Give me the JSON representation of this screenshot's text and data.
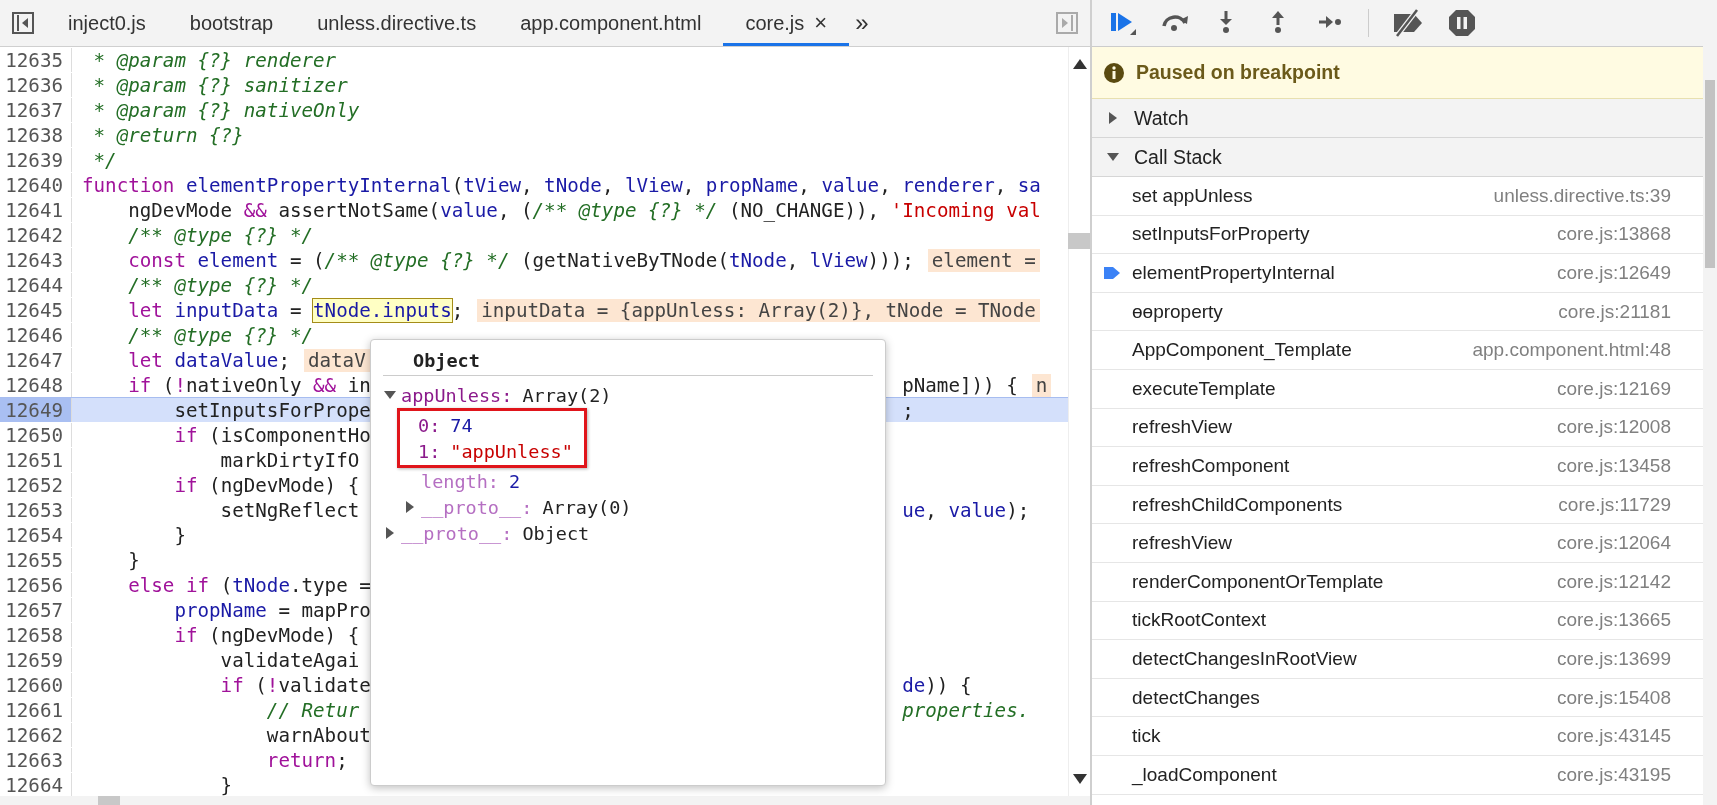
{
  "tabs": [
    {
      "label": "inject0.js",
      "selected": false
    },
    {
      "label": "bootstrap",
      "selected": false
    },
    {
      "label": "unless.directive.ts",
      "selected": false
    },
    {
      "label": "app.component.html",
      "selected": false
    },
    {
      "label": "core.js",
      "selected": true,
      "close": "×"
    }
  ],
  "tab_overflow": "»",
  "code_lines": [
    {
      "number": "12635",
      "current": false,
      "tokens": [
        {
          "kind": "comment",
          "text": " * @param {?} renderer"
        }
      ]
    },
    {
      "number": "12636",
      "current": false,
      "tokens": [
        {
          "kind": "comment",
          "text": " * @param {?} sanitizer"
        }
      ]
    },
    {
      "number": "12637",
      "current": false,
      "tokens": [
        {
          "kind": "comment",
          "text": " * @param {?} nativeOnly"
        }
      ]
    },
    {
      "number": "12638",
      "current": false,
      "tokens": [
        {
          "kind": "comment",
          "text": " * @return {?}"
        }
      ]
    },
    {
      "number": "12639",
      "current": false,
      "tokens": [
        {
          "kind": "comment",
          "text": " */"
        }
      ]
    },
    {
      "number": "12640",
      "current": false,
      "tokens": [
        {
          "kind": "keyword",
          "text": "function"
        },
        {
          "kind": "variable",
          "text": " elementPropertyInternal"
        },
        {
          "kind": "plain",
          "text": "("
        },
        {
          "kind": "variable",
          "text": "tView"
        },
        {
          "kind": "plain",
          "text": ", "
        },
        {
          "kind": "variable",
          "text": "tNode"
        },
        {
          "kind": "plain",
          "text": ", "
        },
        {
          "kind": "variable",
          "text": "lView"
        },
        {
          "kind": "plain",
          "text": ", "
        },
        {
          "kind": "variable",
          "text": "propName"
        },
        {
          "kind": "plain",
          "text": ", "
        },
        {
          "kind": "variable",
          "text": "value"
        },
        {
          "kind": "plain",
          "text": ", "
        },
        {
          "kind": "variable",
          "text": "renderer"
        },
        {
          "kind": "plain",
          "text": ", "
        },
        {
          "kind": "variable",
          "text": "sa"
        }
      ]
    },
    {
      "number": "12641",
      "current": false,
      "tokens": [
        {
          "kind": "plain",
          "text": "    ngDevMode "
        },
        {
          "kind": "keyword",
          "text": "&&"
        },
        {
          "kind": "plain",
          "text": " assertNotSame("
        },
        {
          "kind": "variable",
          "text": "value"
        },
        {
          "kind": "plain",
          "text": ", ("
        },
        {
          "kind": "comment",
          "text": "/** @type {?} */"
        },
        {
          "kind": "plain",
          "text": " (NO_CHANGE)), "
        },
        {
          "kind": "string",
          "text": "'Incoming val"
        }
      ]
    },
    {
      "number": "12642",
      "current": false,
      "tokens": [
        {
          "kind": "comment",
          "text": "    /** @type {?} */"
        }
      ]
    },
    {
      "number": "12643",
      "current": false,
      "tokens": [
        {
          "kind": "keyword",
          "text": "    const"
        },
        {
          "kind": "variable",
          "text": " element"
        },
        {
          "kind": "plain",
          "text": " = ("
        },
        {
          "kind": "comment",
          "text": "/** @type {?} */"
        },
        {
          "kind": "plain",
          "text": " (getNativeByTNode("
        },
        {
          "kind": "variable",
          "text": "tNode"
        },
        {
          "kind": "plain",
          "text": ", "
        },
        {
          "kind": "variable",
          "text": "lView"
        },
        {
          "kind": "plain",
          "text": ")));"
        },
        {
          "kind": "inline",
          "text": "element ="
        }
      ]
    },
    {
      "number": "12644",
      "current": false,
      "tokens": [
        {
          "kind": "comment",
          "text": "    /** @type {?} */"
        }
      ]
    },
    {
      "number": "12645",
      "current": false,
      "tokens": [
        {
          "kind": "keyword",
          "text": "    let"
        },
        {
          "kind": "variable",
          "text": " inputData"
        },
        {
          "kind": "plain",
          "text": " = "
        },
        {
          "kind": "hover",
          "text": "tNode.inputs"
        },
        {
          "kind": "plain",
          "text": ";"
        },
        {
          "kind": "inline",
          "text": "inputData = {appUnless: Array(2)}, tNode = TNode"
        }
      ]
    },
    {
      "number": "12646",
      "current": false,
      "tokens": [
        {
          "kind": "comment",
          "text": "    /** @type {?} */"
        }
      ]
    },
    {
      "number": "12647",
      "current": false,
      "tokens": [
        {
          "kind": "keyword",
          "text": "    let"
        },
        {
          "kind": "variable",
          "text": " dataValue"
        },
        {
          "kind": "plain",
          "text": ";"
        },
        {
          "kind": "inline",
          "text": "dataV"
        }
      ]
    },
    {
      "number": "12648",
      "current": false,
      "tokens": [
        {
          "kind": "keyword",
          "text": "    if"
        },
        {
          "kind": "plain",
          "text": " ("
        },
        {
          "kind": "keyword",
          "text": "!"
        },
        {
          "kind": "plain",
          "text": "nativeOnly "
        },
        {
          "kind": "keyword",
          "text": "&&"
        },
        {
          "kind": "plain",
          "text": " in"
        }
      ],
      "right": [
        {
          "kind": "plain",
          "text": "pName])) {"
        },
        {
          "kind": "inline",
          "text": "n"
        }
      ]
    },
    {
      "number": "12649",
      "current": true,
      "tokens": [
        {
          "kind": "plain",
          "text": "        setInputsForPrope"
        }
      ],
      "right": [
        {
          "kind": "plain",
          "text": ";"
        }
      ]
    },
    {
      "number": "12650",
      "current": false,
      "tokens": [
        {
          "kind": "keyword",
          "text": "        if"
        },
        {
          "kind": "plain",
          "text": " (isComponentHo"
        }
      ]
    },
    {
      "number": "12651",
      "current": false,
      "tokens": [
        {
          "kind": "plain",
          "text": "            markDirtyIfO"
        }
      ]
    },
    {
      "number": "12652",
      "current": false,
      "tokens": [
        {
          "kind": "keyword",
          "text": "        if"
        },
        {
          "kind": "plain",
          "text": " (ngDevMode) {"
        }
      ]
    },
    {
      "number": "12653",
      "current": false,
      "tokens": [
        {
          "kind": "plain",
          "text": "            setNgReflect"
        }
      ],
      "right": [
        {
          "kind": "variable",
          "text": "ue"
        },
        {
          "kind": "plain",
          "text": ", "
        },
        {
          "kind": "variable",
          "text": "value"
        },
        {
          "kind": "plain",
          "text": ");"
        }
      ]
    },
    {
      "number": "12654",
      "current": false,
      "tokens": [
        {
          "kind": "plain",
          "text": "        }"
        }
      ]
    },
    {
      "number": "12655",
      "current": false,
      "tokens": [
        {
          "kind": "plain",
          "text": "    }"
        }
      ]
    },
    {
      "number": "12656",
      "current": false,
      "tokens": [
        {
          "kind": "keyword",
          "text": "    else if"
        },
        {
          "kind": "plain",
          "text": " ("
        },
        {
          "kind": "variable",
          "text": "tNode"
        },
        {
          "kind": "plain",
          "text": ".type ="
        }
      ]
    },
    {
      "number": "12657",
      "current": false,
      "tokens": [
        {
          "kind": "variable",
          "text": "        propName"
        },
        {
          "kind": "plain",
          "text": " = mapPro"
        }
      ]
    },
    {
      "number": "12658",
      "current": false,
      "tokens": [
        {
          "kind": "keyword",
          "text": "        if"
        },
        {
          "kind": "plain",
          "text": " (ngDevMode) {"
        }
      ]
    },
    {
      "number": "12659",
      "current": false,
      "tokens": [
        {
          "kind": "plain",
          "text": "            validateAgai"
        }
      ]
    },
    {
      "number": "12660",
      "current": false,
      "tokens": [
        {
          "kind": "keyword",
          "text": "            if"
        },
        {
          "kind": "plain",
          "text": " ("
        },
        {
          "kind": "keyword",
          "text": "!"
        },
        {
          "kind": "plain",
          "text": "validate"
        }
      ],
      "right": [
        {
          "kind": "variable",
          "text": "de"
        },
        {
          "kind": "plain",
          "text": ")) {"
        }
      ]
    },
    {
      "number": "12661",
      "current": false,
      "tokens": [
        {
          "kind": "comment",
          "text": "                // Retur"
        }
      ],
      "right": [
        {
          "kind": "comment",
          "text": "properties."
        }
      ]
    },
    {
      "number": "12662",
      "current": false,
      "tokens": [
        {
          "kind": "plain",
          "text": "                warnAbout"
        }
      ]
    },
    {
      "number": "12663",
      "current": false,
      "tokens": [
        {
          "kind": "keyword",
          "text": "                return"
        },
        {
          "kind": "plain",
          "text": ";"
        }
      ]
    },
    {
      "number": "12664",
      "current": false,
      "tokens": [
        {
          "kind": "plain",
          "text": "            }"
        }
      ]
    }
  ],
  "popover": {
    "title": "Object",
    "tree": [
      {
        "key": "appUnless:",
        "value": "Array(2)",
        "kind": "plain",
        "expanded": true,
        "children": [
          {
            "key": "0:",
            "value": "74",
            "kind": "number",
            "highlighted": true
          },
          {
            "key": "1:",
            "value": "\"appUnless\"",
            "kind": "string",
            "highlighted": true
          },
          {
            "key": "length:",
            "value": "2",
            "kind": "number",
            "highlighted": false,
            "faded": true
          },
          {
            "key": "__proto__:",
            "value": "Array(0)",
            "kind": "plain",
            "expanded": false,
            "highlighted": false,
            "faded": true
          }
        ]
      },
      {
        "key": "__proto__:",
        "value": "Object",
        "kind": "plain",
        "expanded": false,
        "faded": true
      }
    ]
  },
  "pause_banner": "Paused on breakpoint",
  "sections": [
    {
      "title": "Watch",
      "expanded": false
    },
    {
      "title": "Call Stack",
      "expanded": true
    }
  ],
  "call_stack": [
    {
      "name": "set appUnless",
      "location": "unless.directive.ts:39",
      "selected": false
    },
    {
      "name": "setInputsForProperty",
      "location": "core.js:13868",
      "selected": false
    },
    {
      "name": "elementPropertyInternal",
      "location": "core.js:12649",
      "selected": true
    },
    {
      "name": "ɵɵproperty",
      "location": "core.js:21181",
      "selected": false
    },
    {
      "name": "AppComponent_Template",
      "location": "app.component.html:48",
      "selected": false
    },
    {
      "name": "executeTemplate",
      "location": "core.js:12169",
      "selected": false
    },
    {
      "name": "refreshView",
      "location": "core.js:12008",
      "selected": false
    },
    {
      "name": "refreshComponent",
      "location": "core.js:13458",
      "selected": false
    },
    {
      "name": "refreshChildComponents",
      "location": "core.js:11729",
      "selected": false
    },
    {
      "name": "refreshView",
      "location": "core.js:12064",
      "selected": false
    },
    {
      "name": "renderComponentOrTemplate",
      "location": "core.js:12142",
      "selected": false
    },
    {
      "name": "tickRootContext",
      "location": "core.js:13665",
      "selected": false
    },
    {
      "name": "detectChangesInRootView",
      "location": "core.js:13699",
      "selected": false
    },
    {
      "name": "detectChanges",
      "location": "core.js:15408",
      "selected": false
    },
    {
      "name": "tick",
      "location": "core.js:43145",
      "selected": false
    },
    {
      "name": "_loadComponent",
      "location": "core.js:43195",
      "selected": false
    }
  ]
}
